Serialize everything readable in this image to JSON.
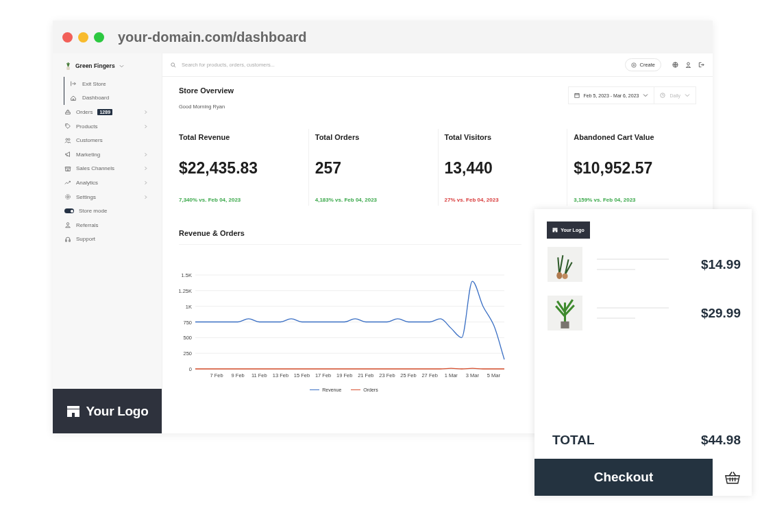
{
  "browser": {
    "dots": [
      {
        "color": "#f25f58"
      },
      {
        "color": "#f8bb2d"
      },
      {
        "color": "#2cc840"
      }
    ],
    "address": "your-domain.com/dashboard"
  },
  "sidebar": {
    "store_name": "Green Fingers",
    "items": [
      {
        "kind": "link",
        "label": "Exit Store",
        "expandable": false,
        "nested": true
      },
      {
        "kind": "link",
        "label": "Dashboard",
        "expandable": false,
        "nested": true
      },
      {
        "kind": "link",
        "label": "Orders",
        "badge": "1289",
        "expandable": true,
        "nested": false
      },
      {
        "kind": "link",
        "label": "Products",
        "expandable": true,
        "nested": false
      },
      {
        "kind": "link",
        "label": "Customers",
        "expandable": false,
        "nested": false
      },
      {
        "kind": "link",
        "label": "Marketing",
        "expandable": true,
        "nested": false
      },
      {
        "kind": "link",
        "label": "Sales Channels",
        "expandable": true,
        "nested": false
      },
      {
        "kind": "link",
        "label": "Analytics",
        "expandable": true,
        "nested": false
      },
      {
        "kind": "link",
        "label": "Settings",
        "expandable": true,
        "nested": false
      },
      {
        "kind": "toggle",
        "label": "Store mode",
        "on": true
      },
      {
        "kind": "link",
        "label": "Referrals",
        "expandable": false,
        "nested": false
      },
      {
        "kind": "link",
        "label": "Support",
        "expandable": false,
        "nested": false
      }
    ],
    "logo": "Your Logo"
  },
  "topbar": {
    "search": {
      "placeholder": "Search for products, orders, customers..."
    },
    "create_button": "Create"
  },
  "overview": {
    "title": "Store Overview",
    "greeting": "Good Morning Ryan",
    "date_range": "Feb 5, 2023 - Mar 6, 2023",
    "interval": {
      "label": "Daily",
      "disabled": true
    }
  },
  "kpis": [
    {
      "label": "Total Revenue",
      "value": "$22,435.83",
      "change": "7,340% vs. Feb 04, 2023",
      "color": "#3aa84a"
    },
    {
      "label": "Total Orders",
      "value": "257",
      "change": "4,183% vs. Feb 04, 2023",
      "color": "#3aa84a"
    },
    {
      "label": "Total Visitors",
      "value": "13,440",
      "change": "27% vs. Feb 04, 2023",
      "color": "#d83a3a"
    },
    {
      "label": "Abandoned Cart Value",
      "value": "$10,952.57",
      "change": "3,159% vs. Feb 04, 2023",
      "color": "#3aa84a"
    }
  ],
  "revenue_chart": {
    "title": "Revenue & Orders",
    "chart_data": {
      "type": "line",
      "categories": [
        null,
        null,
        "7 Feb",
        null,
        "9 Feb",
        null,
        "11 Feb",
        null,
        "13 Feb",
        null,
        "15 Feb",
        null,
        "17 Feb",
        null,
        "19 Feb",
        null,
        "21 Feb",
        null,
        "23 Feb",
        null,
        "25 Feb",
        null,
        "27 Feb",
        null,
        "1 Mar",
        null,
        "3 Mar",
        null,
        "5 Mar",
        null
      ],
      "series": [
        {
          "name": "Revenue",
          "color": "#3a6fc4",
          "values": [
            750,
            750,
            750,
            750,
            750,
            800,
            750,
            750,
            750,
            800,
            750,
            750,
            750,
            750,
            750,
            800,
            750,
            750,
            750,
            800,
            750,
            750,
            750,
            800,
            650,
            500,
            1400,
            1000,
            700,
            150
          ]
        },
        {
          "name": "Orders",
          "color": "#d9502f",
          "values": [
            0,
            0,
            0,
            0,
            0,
            0,
            0,
            0,
            0,
            0,
            0,
            0,
            0,
            0,
            0,
            0,
            0,
            0,
            0,
            0,
            0,
            0,
            0,
            0,
            10,
            0,
            10,
            0,
            0,
            0
          ]
        }
      ],
      "ylim": [
        0,
        1500
      ],
      "grid": true,
      "legend": true,
      "yticks": [
        0,
        250,
        500,
        750,
        {
          "value": 1000,
          "label": "1K"
        },
        {
          "value": 1250,
          "label": "1.25K"
        },
        {
          "value": 1500,
          "label": "1.5K"
        }
      ]
    }
  },
  "cart": {
    "logo": "Your Logo",
    "items": [
      {
        "price": "$14.99"
      },
      {
        "price": "$29.99"
      }
    ],
    "total_label": "TOTAL",
    "total": "$44.98",
    "checkout": "Checkout"
  }
}
